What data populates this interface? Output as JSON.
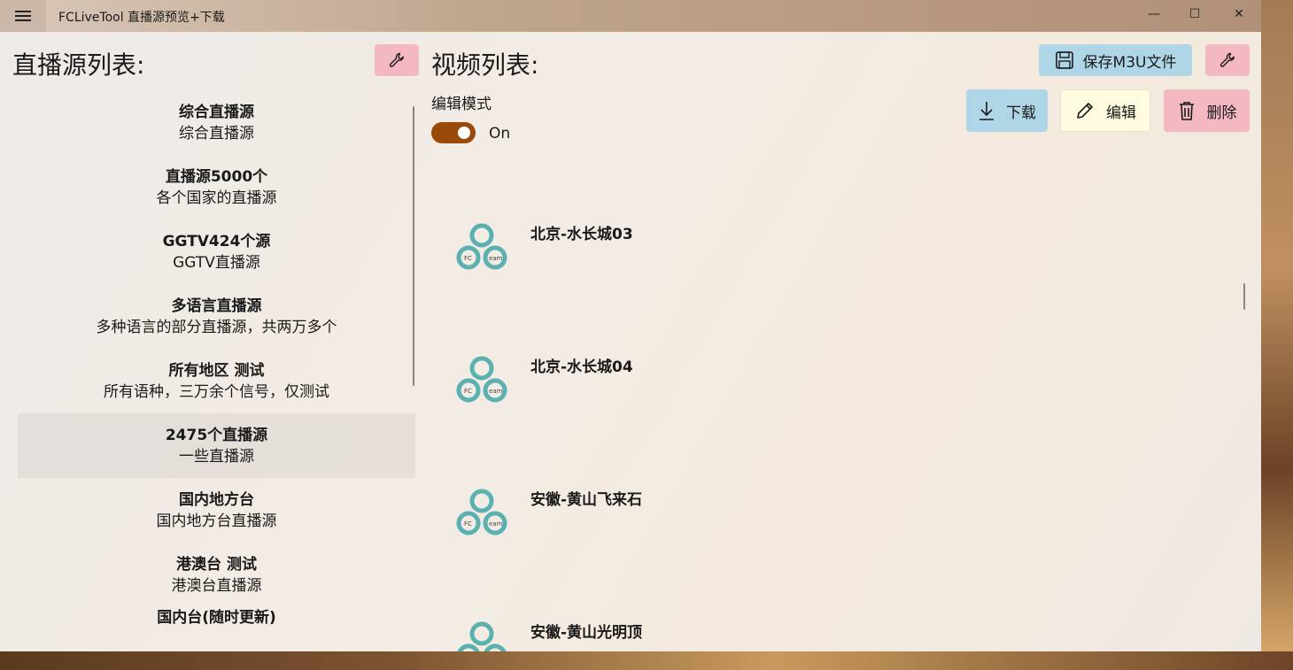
{
  "window": {
    "title": "FCLiveTool 直播源预览+下载",
    "controls": {
      "minimize": "—",
      "maximize": "☐",
      "close": "✕"
    }
  },
  "left": {
    "header": "直播源列表:",
    "sources": [
      {
        "name": "综合直播源",
        "desc": "综合直播源"
      },
      {
        "name": "直播源5000个",
        "desc": "各个国家的直播源"
      },
      {
        "name": "GGTV424个源",
        "desc": "GGTV直播源"
      },
      {
        "name": "多语言直播源",
        "desc": "多种语言的部分直播源，共两万多个"
      },
      {
        "name": "所有地区 测试",
        "desc": "所有语种，三万余个信号，仅测试"
      },
      {
        "name": "2475个直播源",
        "desc": "一些直播源",
        "selected": true
      },
      {
        "name": "国内地方台",
        "desc": "国内地方台直播源"
      },
      {
        "name": "港澳台 测试",
        "desc": "港澳台直播源"
      },
      {
        "name": "国内台(随时更新)",
        "desc": ""
      }
    ]
  },
  "right": {
    "header": "视频列表:",
    "save_label": "保存M3U文件",
    "edit_mode_label": "编辑模式",
    "toggle_state": "On",
    "download_label": "下载",
    "edit_label": "编辑",
    "delete_label": "删除",
    "videos": [
      {
        "name": "北京-水长城03"
      },
      {
        "name": "北京-水长城04"
      },
      {
        "name": "安徽-黄山飞来石"
      },
      {
        "name": "安徽-黄山光明顶"
      }
    ]
  },
  "colors": {
    "accent_toggle": "#9a4a08",
    "pink_button": "#f4b8c3",
    "blue_button": "#aed6e6",
    "yellow_button": "#fffbe0",
    "logo_teal": "#5bb0b0"
  }
}
